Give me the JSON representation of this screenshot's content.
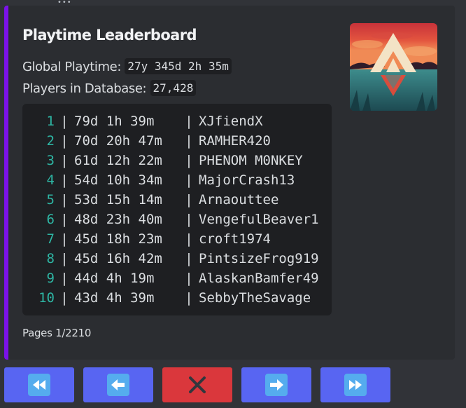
{
  "embed": {
    "title": "Playtime Leaderboard",
    "global_playtime_label": "Global Playtime:",
    "global_playtime_value": "27y 345d 2h 35m",
    "players_label": "Players in Database:",
    "players_value": "27,428",
    "accent_color": "#7b12e9",
    "thumbnail": "mountain-sunset-logo",
    "leaderboard": [
      {
        "rank": "1",
        "time": "79d 1h 39m",
        "name": "XJfiendX"
      },
      {
        "rank": "2",
        "time": "70d 20h 47m",
        "name": "RAMHER420"
      },
      {
        "rank": "3",
        "time": "61d 12h 22m",
        "name": "PHENOM M0NKEY"
      },
      {
        "rank": "4",
        "time": "54d 10h 34m",
        "name": "MajorCrash13"
      },
      {
        "rank": "5",
        "time": "53d 15h 14m",
        "name": "Arnaouttee"
      },
      {
        "rank": "6",
        "time": "48d 23h 40m",
        "name": "VengefulBeaver1"
      },
      {
        "rank": "7",
        "time": "45d 18h 23m",
        "name": "croft1974"
      },
      {
        "rank": "8",
        "time": "45d 16h 42m",
        "name": "PintsizeFrog919"
      },
      {
        "rank": "9",
        "time": "44d 4h 19m",
        "name": "AlaskanBamfer49"
      },
      {
        "rank": "10",
        "time": "43d 4h 39m",
        "name": "SebbyTheSavage"
      }
    ],
    "separator": "|",
    "footer": "Pages 1/2210"
  },
  "buttons": [
    {
      "icon": "rewind-icon",
      "style": "primary",
      "color": "#5865f2"
    },
    {
      "icon": "arrow-left-icon",
      "style": "primary",
      "color": "#5865f2"
    },
    {
      "icon": "close-x-icon",
      "style": "danger",
      "color": "#da373c"
    },
    {
      "icon": "arrow-right-icon",
      "style": "primary",
      "color": "#5865f2"
    },
    {
      "icon": "fast-forward-icon",
      "style": "primary",
      "color": "#5865f2"
    }
  ]
}
